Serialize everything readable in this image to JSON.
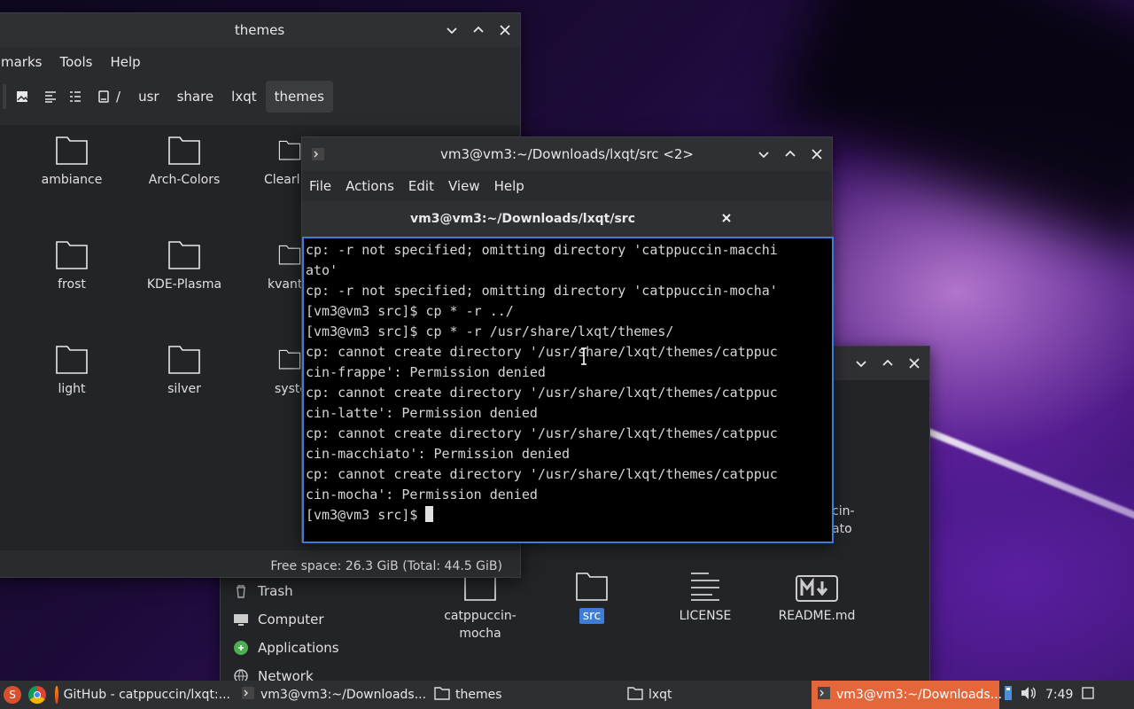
{
  "colors": {
    "accent": "#3d7dd8",
    "taskbar_active": "#e3673a",
    "terminal_bg": "#000000"
  },
  "back_fm": {
    "sidebar": [
      {
        "icon": "trash-icon",
        "label": "Trash"
      },
      {
        "icon": "computer-icon",
        "label": "Computer"
      },
      {
        "icon": "applications-icon",
        "label": "Applications"
      },
      {
        "icon": "network-icon",
        "label": "Network"
      }
    ],
    "partial_labels": [
      "cin-",
      "ato"
    ],
    "files": [
      {
        "label": "catppuccin-\nmocha",
        "icon": "folder-icon"
      },
      {
        "label": "src",
        "icon": "folder-icon",
        "selected": true
      },
      {
        "label": "LICENSE",
        "icon": "text-file-icon"
      },
      {
        "label": "README.md",
        "icon": "markdown-file-icon"
      }
    ]
  },
  "themes_fm": {
    "title": "themes",
    "menu": [
      "marks",
      "Tools",
      "Help"
    ],
    "path": [
      "/",
      "usr",
      "share",
      "lxqt",
      "themes"
    ],
    "folders": [
      "ambiance",
      "Arch-Colors",
      "Clearl",
      "frost",
      "KDE-Plasma",
      "kvant",
      "light",
      "silver",
      "syste"
    ],
    "status": "Free space: 26.3 GiB (Total: 44.5 GiB)"
  },
  "terminal": {
    "title": "vm3@vm3:~/Downloads/lxqt/src <2>",
    "menu": [
      "File",
      "Actions",
      "Edit",
      "View",
      "Help"
    ],
    "tab_label": "vm3@vm3:~/Downloads/lxqt/src",
    "lines": [
      "cp: -r not specified; omitting directory 'catppuccin-macchi",
      "ato'",
      "cp: -r not specified; omitting directory 'catppuccin-mocha'",
      "[vm3@vm3 src]$ cp * -r ../",
      "[vm3@vm3 src]$ cp * -r /usr/share/lxqt/themes/",
      "cp: cannot create directory '/usr/share/lxqt/themes/catppuc",
      "cin-frappe': Permission denied",
      "cp: cannot create directory '/usr/share/lxqt/themes/catppuc",
      "cin-latte': Permission denied",
      "cp: cannot create directory '/usr/share/lxqt/themes/catppuc",
      "cin-macchiato': Permission denied",
      "cp: cannot create directory '/usr/share/lxqt/themes/catppuc",
      "cin-mocha': Permission denied"
    ],
    "prompt": "[vm3@vm3 src]$ "
  },
  "taskbar": {
    "items": [
      {
        "icon": "firefox-icon",
        "label": "GitHub - catppuccin/lxqt:..."
      },
      {
        "icon": "terminal-icon",
        "label": "vm3@vm3:~/Downloads..."
      },
      {
        "icon": "folder-icon",
        "label": "themes"
      },
      {
        "icon": "folder-icon",
        "label": "lxqt"
      },
      {
        "icon": "terminal-icon",
        "label": "vm3@vm3:~/Downloads...",
        "active": true
      }
    ],
    "clock": "7:49"
  }
}
